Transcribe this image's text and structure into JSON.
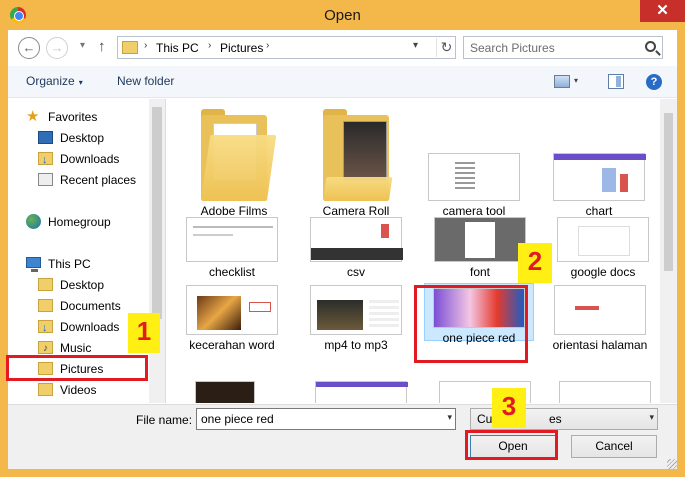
{
  "window": {
    "title": "Open",
    "close_glyph": "✕"
  },
  "nav": {
    "back_glyph": "←",
    "forward_glyph": "→",
    "recent_glyph": "▾",
    "up_glyph": "↑"
  },
  "address": {
    "separator": "›",
    "crumbs": [
      "This PC",
      "Pictures"
    ],
    "dropdown_glyph": "▾",
    "refresh_glyph": "↻"
  },
  "search": {
    "placeholder": "Search Pictures"
  },
  "toolbar": {
    "organize_label": "Organize",
    "caret": "▾",
    "new_folder_label": "New folder",
    "help_glyph": "?"
  },
  "sidebar": {
    "favorites_header": "Favorites",
    "favorites": [
      {
        "label": "Desktop",
        "icon": "desktop-icon"
      },
      {
        "label": "Downloads",
        "icon": "downloads-folder-icon"
      },
      {
        "label": "Recent places",
        "icon": "recent-places-icon"
      }
    ],
    "homegroup": "Homegroup",
    "this_pc_header": "This PC",
    "this_pc_items": [
      {
        "label": "Desktop",
        "icon": "desktop-folder-icon"
      },
      {
        "label": "Documents",
        "icon": "documents-folder-icon"
      },
      {
        "label": "Downloads",
        "icon": "downloads-folder-icon"
      },
      {
        "label": "Music",
        "icon": "music-folder-icon"
      },
      {
        "label": "Pictures",
        "icon": "pictures-folder-icon"
      },
      {
        "label": "Videos",
        "icon": "videos-folder-icon"
      }
    ]
  },
  "files": [
    {
      "name": "Adobe Films",
      "kind": "folder"
    },
    {
      "name": "Camera Roll",
      "kind": "folder"
    },
    {
      "name": "camera tool",
      "kind": "image"
    },
    {
      "name": "chart",
      "kind": "image"
    },
    {
      "name": "checklist",
      "kind": "image"
    },
    {
      "name": "csv",
      "kind": "image"
    },
    {
      "name": "font",
      "kind": "image"
    },
    {
      "name": "google docs",
      "kind": "image"
    },
    {
      "name": "kecerahan word",
      "kind": "image"
    },
    {
      "name": "mp4 to mp3",
      "kind": "image"
    },
    {
      "name": "one piece red",
      "kind": "image",
      "selected": true
    },
    {
      "name": "orientasi halaman",
      "kind": "image"
    }
  ],
  "footer": {
    "file_name_label": "File name:",
    "file_name_value": "one piece red",
    "dropdown_glyph": "▾",
    "file_type_visible": "Cus",
    "file_type_visible_tail": "es",
    "open_label": "Open",
    "cancel_label": "Cancel"
  },
  "annotations": [
    {
      "number": "1",
      "target": "Pictures"
    },
    {
      "number": "2",
      "target": "one piece red"
    },
    {
      "number": "3",
      "target": "Open"
    }
  ],
  "colors": {
    "titlebar": "#f3b74a",
    "close_button": "#c7302a",
    "annotation_red": "#e21b23",
    "annotation_yellow": "#ffef12",
    "selection": "#cce8ff"
  }
}
